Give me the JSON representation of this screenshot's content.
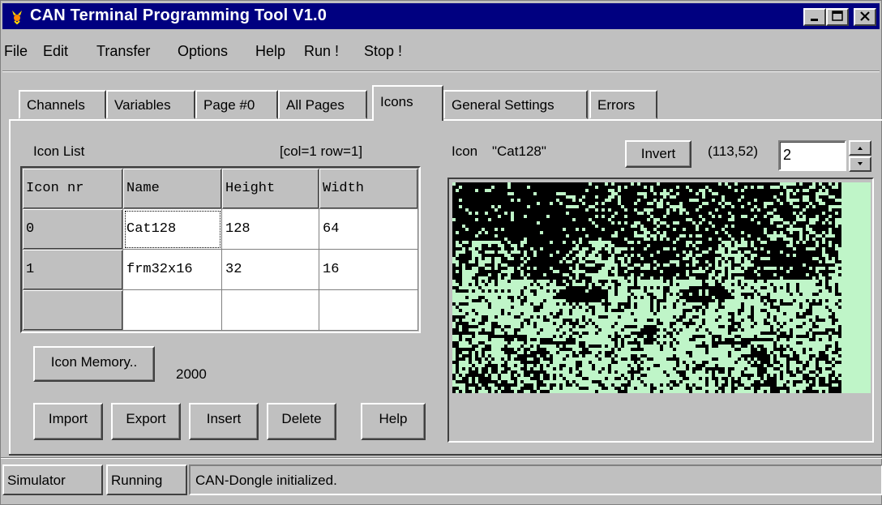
{
  "window": {
    "title": "CAN Terminal Programming Tool V1.0",
    "controls": [
      "minimize-icon",
      "maximize-icon",
      "close-icon"
    ]
  },
  "menu": {
    "file": "File",
    "edit": "Edit",
    "transfer": "Transfer",
    "options": "Options",
    "help": "Help",
    "run": "Run !",
    "stop": "Stop !"
  },
  "tabs": [
    "Channels",
    "Variables",
    "Page #0",
    "All Pages",
    "Icons",
    "General Settings",
    "Errors"
  ],
  "active_tab": "Icons",
  "icon_list": {
    "label": "Icon List",
    "position": "[col=1 row=1]",
    "columns": [
      "Icon nr",
      "Name",
      "Height",
      "Width"
    ],
    "rows": [
      {
        "nr": "0",
        "name": "Cat128",
        "height": "128",
        "width": "64"
      },
      {
        "nr": "1",
        "name": "frm32x16",
        "height": "32",
        "width": "16"
      },
      {
        "nr": "",
        "name": "",
        "height": "",
        "width": ""
      }
    ]
  },
  "memory": {
    "button": "Icon Memory..",
    "value": "2000"
  },
  "actions": {
    "import": "Import",
    "export": "Export",
    "insert": "Insert",
    "delete": "Delete",
    "help": "Help"
  },
  "icon_view": {
    "label": "Icon",
    "name": "\"Cat128\"",
    "invert": "Invert",
    "coords": "(113,52)",
    "zoom": "2"
  },
  "colors": {
    "titlebar": "#000080",
    "pixel_on": "#bff5c8",
    "pixel_off": "#000000"
  },
  "status": {
    "mode": "Simulator",
    "state": "Running",
    "message": "CAN-Dongle initialized."
  }
}
